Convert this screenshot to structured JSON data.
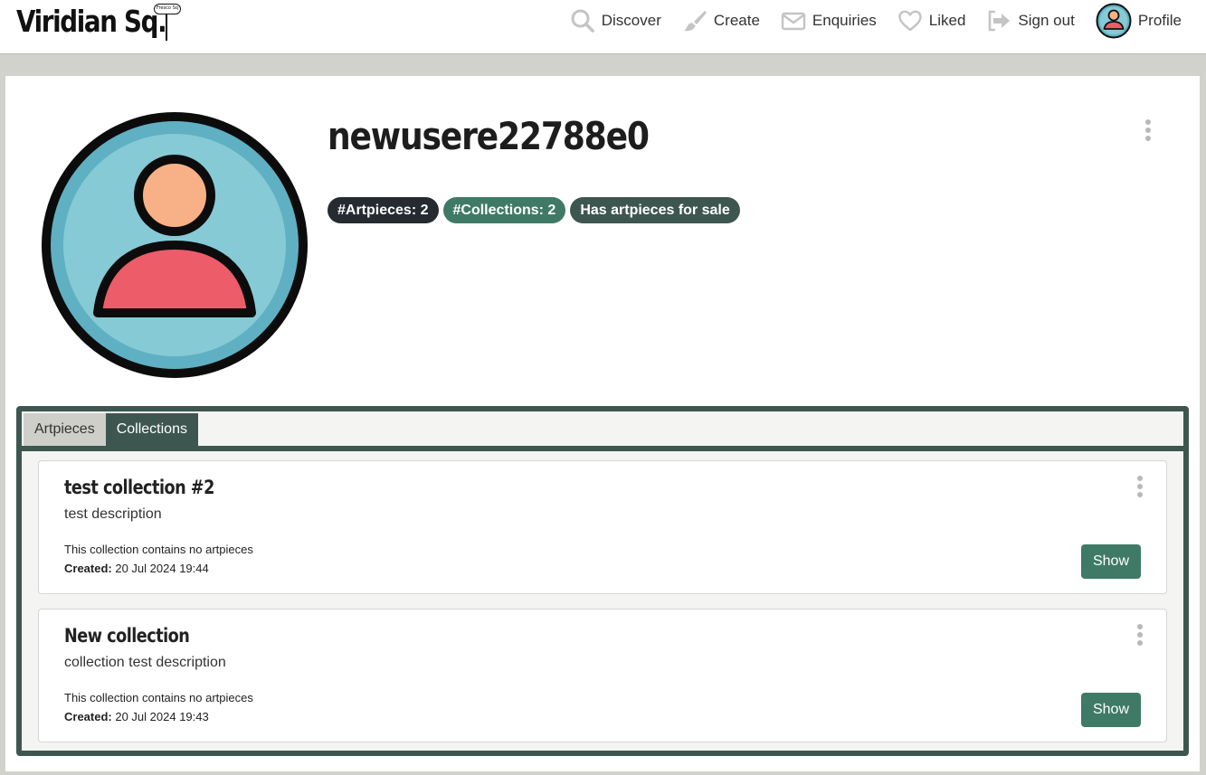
{
  "brand": {
    "name": "Viridian Sq.",
    "sign_text": "Fresco Sq"
  },
  "nav": {
    "discover": "Discover",
    "create": "Create",
    "enquiries": "Enquiries",
    "liked": "Liked",
    "sign_out": "Sign out",
    "profile": "Profile"
  },
  "profile": {
    "username": "newusere22788e0",
    "badges": [
      {
        "label": "#Artpieces: 2",
        "color": "#262a31"
      },
      {
        "label": "#Collections: 2",
        "color": "#3f7a66"
      },
      {
        "label": "Has artpieces for sale",
        "color": "#3e5650"
      }
    ]
  },
  "tabs": [
    {
      "label": "Artpieces",
      "active": false
    },
    {
      "label": "Collections",
      "active": true
    }
  ],
  "collections": [
    {
      "title": "test collection #2",
      "description": "test description",
      "info": "This collection contains no artpieces",
      "created_label": "Created:",
      "created_value": "20 Jul 2024 19:44",
      "button_label": "Show"
    },
    {
      "title": "New collection",
      "description": "collection test description",
      "info": "This collection contains no artpieces",
      "created_label": "Created:",
      "created_value": "20 Jul 2024 19:43",
      "button_label": "Show"
    }
  ],
  "colors": {
    "accent": "#3f7a66",
    "panel_border": "#3e5650",
    "page_background": "#d2d2cc",
    "avatar_ring": "#5fb0c2",
    "avatar_fill": "#86cad6",
    "avatar_head": "#f8b186",
    "avatar_body": "#ec5c69"
  },
  "icons": {
    "discover": "search-icon",
    "create": "paintbrush-icon",
    "enquiries": "envelope-icon",
    "liked": "heart-icon",
    "sign_out": "sign-out-icon",
    "profile": "user-avatar-icon"
  }
}
